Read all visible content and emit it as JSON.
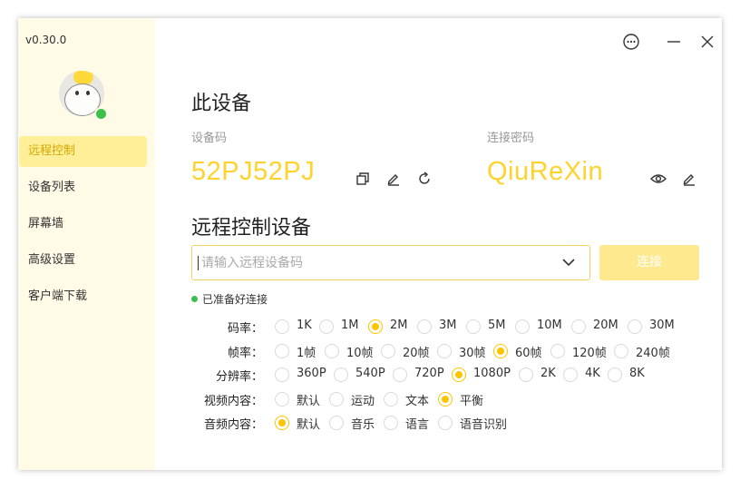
{
  "app": {
    "version": "v0.30.0"
  },
  "sidebar": {
    "items": [
      {
        "label": "远程控制",
        "active": true
      },
      {
        "label": "设备列表",
        "active": false
      },
      {
        "label": "屏幕墙",
        "active": false
      },
      {
        "label": "高级设置",
        "active": false
      },
      {
        "label": "客户端下载",
        "active": false
      }
    ]
  },
  "device": {
    "title": "此设备",
    "code_label": "设备码",
    "code": "52PJ52PJ",
    "password_label": "连接密码",
    "password": "QiuReXin"
  },
  "remote": {
    "title": "远程控制设备",
    "placeholder": "请输入远程设备码",
    "connect_label": "连接",
    "status": "已准备好连接"
  },
  "options": [
    {
      "label": "码率：",
      "choices": [
        "1K",
        "1M",
        "2M",
        "3M",
        "5M",
        "10M",
        "20M",
        "30M"
      ],
      "selected": "2M"
    },
    {
      "label": "帧率：",
      "choices": [
        "1帧",
        "10帧",
        "20帧",
        "30帧",
        "60帧",
        "120帧",
        "240帧"
      ],
      "selected": "60帧"
    },
    {
      "label": "分辨率：",
      "choices": [
        "360P",
        "540P",
        "720P",
        "1080P",
        "2K",
        "4K",
        "8K"
      ],
      "selected": "1080P"
    },
    {
      "label": "视频内容：",
      "choices": [
        "默认",
        "运动",
        "文本",
        "平衡"
      ],
      "selected": "平衡"
    },
    {
      "label": "音频内容：",
      "choices": [
        "默认",
        "音乐",
        "语言",
        "语音识别"
      ],
      "selected": "默认"
    }
  ],
  "colors": {
    "accent": "#ffd22e",
    "sidebar_bg": "#fffbe6",
    "online": "#3cc04c"
  }
}
